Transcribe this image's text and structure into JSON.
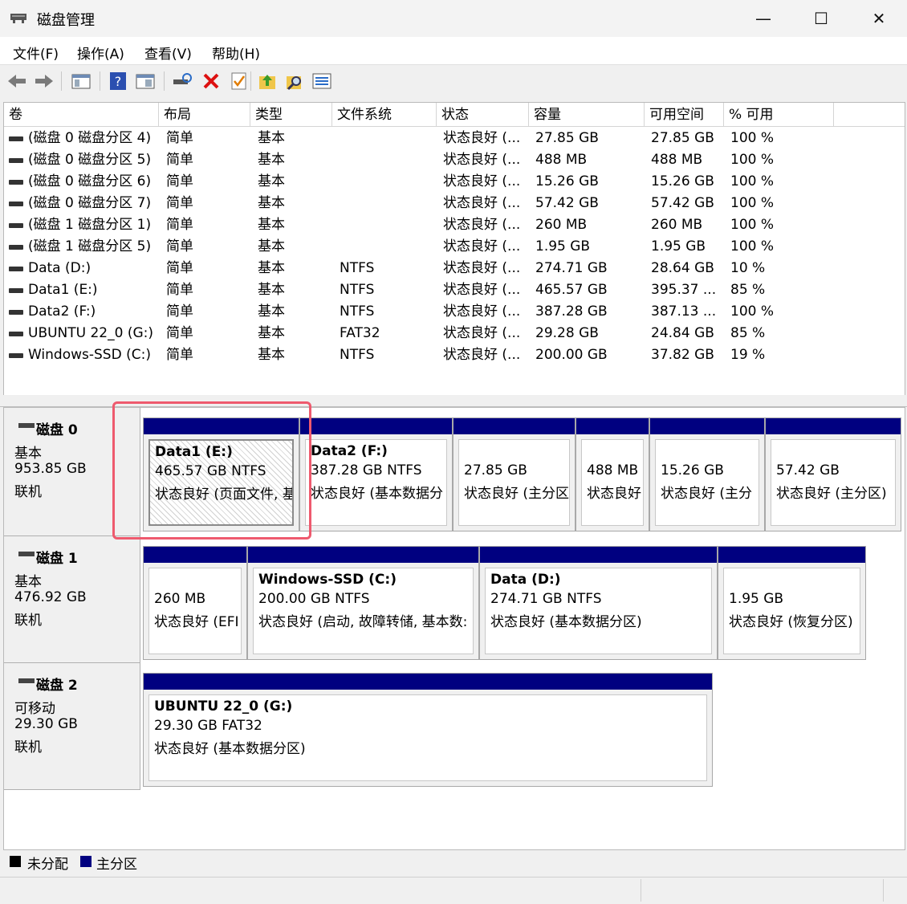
{
  "window": {
    "title": "磁盘管理",
    "minimize": "—",
    "maximize": "☐",
    "close": "✕"
  },
  "menu": [
    {
      "label": "文件(F)"
    },
    {
      "label": "操作(A)"
    },
    {
      "label": "查看(V)"
    },
    {
      "label": "帮助(H)"
    }
  ],
  "toolbar": [
    "back-icon",
    "forward-icon",
    "show-hide-console-tree-icon",
    "help-icon",
    "properties-icon",
    "connect-disk-icon",
    "delete-icon",
    "check-icon",
    "up-folder-icon",
    "search-icon",
    "list-view-icon"
  ],
  "columns": [
    "卷",
    "布局",
    "类型",
    "文件系统",
    "状态",
    "容量",
    "可用空间",
    "% 可用"
  ],
  "volumes": [
    {
      "name": "(磁盘 0 磁盘分区 4)",
      "layout": "简单",
      "type": "基本",
      "fs": "",
      "status": "状态良好 (...",
      "capacity": "27.85 GB",
      "free": "27.85 GB",
      "pct": "100 %"
    },
    {
      "name": "(磁盘 0 磁盘分区 5)",
      "layout": "简单",
      "type": "基本",
      "fs": "",
      "status": "状态良好 (...",
      "capacity": "488 MB",
      "free": "488 MB",
      "pct": "100 %"
    },
    {
      "name": "(磁盘 0 磁盘分区 6)",
      "layout": "简单",
      "type": "基本",
      "fs": "",
      "status": "状态良好 (...",
      "capacity": "15.26 GB",
      "free": "15.26 GB",
      "pct": "100 %"
    },
    {
      "name": "(磁盘 0 磁盘分区 7)",
      "layout": "简单",
      "type": "基本",
      "fs": "",
      "status": "状态良好 (...",
      "capacity": "57.42 GB",
      "free": "57.42 GB",
      "pct": "100 %"
    },
    {
      "name": "(磁盘 1 磁盘分区 1)",
      "layout": "简单",
      "type": "基本",
      "fs": "",
      "status": "状态良好 (...",
      "capacity": "260 MB",
      "free": "260 MB",
      "pct": "100 %"
    },
    {
      "name": "(磁盘 1 磁盘分区 5)",
      "layout": "简单",
      "type": "基本",
      "fs": "",
      "status": "状态良好 (...",
      "capacity": "1.95 GB",
      "free": "1.95 GB",
      "pct": "100 %"
    },
    {
      "name": "Data (D:)",
      "layout": "简单",
      "type": "基本",
      "fs": "NTFS",
      "status": "状态良好 (...",
      "capacity": "274.71 GB",
      "free": "28.64 GB",
      "pct": "10 %"
    },
    {
      "name": "Data1 (E:)",
      "layout": "简单",
      "type": "基本",
      "fs": "NTFS",
      "status": "状态良好 (...",
      "capacity": "465.57 GB",
      "free": "395.37 ...",
      "pct": "85 %"
    },
    {
      "name": "Data2 (F:)",
      "layout": "简单",
      "type": "基本",
      "fs": "NTFS",
      "status": "状态良好 (...",
      "capacity": "387.28 GB",
      "free": "387.13 ...",
      "pct": "100 %"
    },
    {
      "name": "UBUNTU 22_0 (G:)",
      "layout": "简单",
      "type": "基本",
      "fs": "FAT32",
      "status": "状态良好 (...",
      "capacity": "29.28 GB",
      "free": "24.84 GB",
      "pct": "85 %"
    },
    {
      "name": "Windows-SSD (C:)",
      "layout": "简单",
      "type": "基本",
      "fs": "NTFS",
      "status": "状态良好 (...",
      "capacity": "200.00 GB",
      "free": "37.82 GB",
      "pct": "19 %"
    }
  ],
  "disks": [
    {
      "name": "磁盘 0",
      "kind": "基本",
      "size": "953.85 GB",
      "state": "联机",
      "partitions": [
        {
          "title": "Data1  (E:)",
          "line1": "465.57 GB NTFS",
          "line2": "状态良好 (页面文件, 基"
        },
        {
          "title": "Data2  (F:)",
          "line1": "387.28 GB NTFS",
          "line2": "状态良好 (基本数据分"
        },
        {
          "title": "",
          "line1": "27.85 GB",
          "line2": "状态良好 (主分区"
        },
        {
          "title": "",
          "line1": "488 MB",
          "line2": "状态良好"
        },
        {
          "title": "",
          "line1": "15.26 GB",
          "line2": "状态良好 (主分"
        },
        {
          "title": "",
          "line1": "57.42 GB",
          "line2": "状态良好 (主分区)"
        }
      ]
    },
    {
      "name": "磁盘 1",
      "kind": "基本",
      "size": "476.92 GB",
      "state": "联机",
      "partitions": [
        {
          "title": "",
          "line1": "260 MB",
          "line2": "状态良好 (EFI"
        },
        {
          "title": "Windows-SSD  (C:)",
          "line1": "200.00 GB NTFS",
          "line2": "状态良好 (启动, 故障转储, 基本数:"
        },
        {
          "title": "Data  (D:)",
          "line1": "274.71 GB NTFS",
          "line2": "状态良好 (基本数据分区)"
        },
        {
          "title": "",
          "line1": "1.95 GB",
          "line2": "状态良好 (恢复分区)"
        }
      ]
    },
    {
      "name": "磁盘 2",
      "kind": "可移动",
      "size": "29.30 GB",
      "state": "联机",
      "partitions": [
        {
          "title": "UBUNTU 22_0  (G:)",
          "line1": "29.30 GB FAT32",
          "line2": "状态良好 (基本数据分区)"
        }
      ]
    }
  ],
  "legend": [
    {
      "label": "未分配",
      "color": "#000000"
    },
    {
      "label": "主分区",
      "color": "#000080"
    }
  ],
  "colors": {
    "partition_header": "#000080",
    "highlight_box": "#ee5a6e",
    "delete_icon": "#dd1111"
  }
}
